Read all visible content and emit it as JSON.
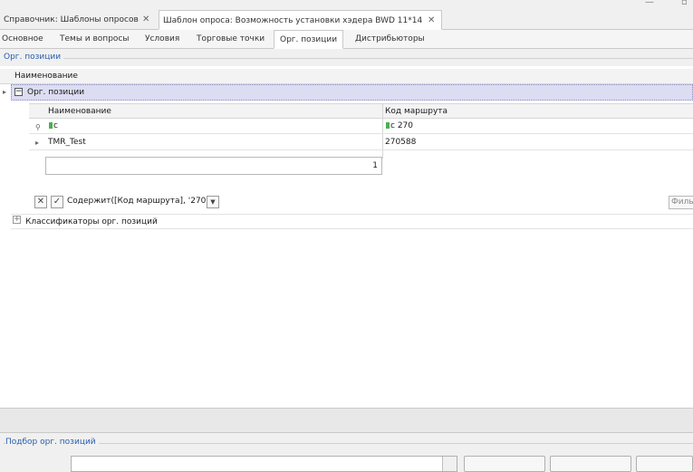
{
  "doc_tabs": [
    {
      "label": "Справочник: Шаблоны опросов",
      "active": false
    },
    {
      "label": "Шаблон опроса: Возможность установки хэдера BWD 11*14",
      "active": true
    }
  ],
  "sub_tabs": [
    {
      "label": "Основное"
    },
    {
      "label": "Темы и вопросы"
    },
    {
      "label": "Условия"
    },
    {
      "label": "Торговые точки"
    },
    {
      "label": "Орг. позиции",
      "active": true
    },
    {
      "label": "Дистрибьюторы"
    }
  ],
  "org_group_title": "Орг. позиции",
  "master_grid": {
    "header_name": "Наименование",
    "group_row_label": "Орг. позиции",
    "classifiers_label": "Классификаторы орг. позиций"
  },
  "detail_grid": {
    "columns": [
      "Наименование",
      "Код маршрута"
    ],
    "filter_row": {
      "name_prefix": "c",
      "code_prefix": "c",
      "code_value": "270"
    },
    "rows": [
      {
        "name": "TMR_Test",
        "code": "270588"
      }
    ],
    "count": "1"
  },
  "filter_bar": {
    "expression": "Содержит([Код маршрута], '270')",
    "editor_label": "Филь"
  },
  "selection_group_title": "Подбор орг. позиций",
  "colors": {
    "accent": "#2a5db0",
    "group_row": "#dcdcf2"
  },
  "icons": [
    "close-x-icon",
    "filter-icon",
    "checkbox-icon",
    "dropdown-arrow-icon",
    "minus-expander-icon",
    "plus-expander-icon",
    "row-pointer-icon"
  ]
}
